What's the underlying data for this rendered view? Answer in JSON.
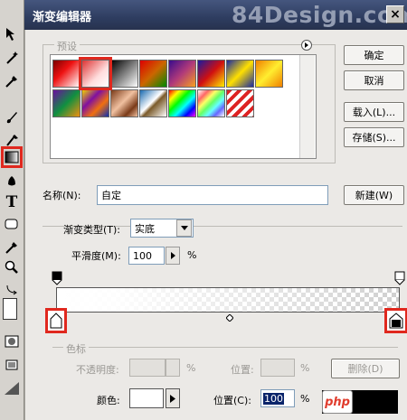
{
  "dialog": {
    "title": "渐变编辑器",
    "watermark": "84Design.com",
    "close_label": "×"
  },
  "buttons": {
    "ok": "确定",
    "cancel": "取消",
    "load": "载入(L)...",
    "save": "存储(S)...",
    "new": "新建(W)",
    "delete": "删除(D)"
  },
  "presets": {
    "label": "预设",
    "swatches": [
      {
        "name": "fg-to-bg",
        "bg": "linear-gradient(135deg,#7a0000,#e11 40%,#fff)"
      },
      {
        "name": "fg-to-transparent",
        "bg": "linear-gradient(135deg,#d33,#fdd 60%,#fff)"
      },
      {
        "name": "black-white",
        "bg": "linear-gradient(135deg,#000,#fff)"
      },
      {
        "name": "red-green",
        "bg": "linear-gradient(135deg,#d00,#c60 50%,#080)"
      },
      {
        "name": "violet-orange",
        "bg": "linear-gradient(135deg,#3a0c8c,#b03a7a 50%,#f7a020)"
      },
      {
        "name": "blue-red-yellow",
        "bg": "linear-gradient(135deg,#1a1aa0,#d01010 50%,#ffee00)"
      },
      {
        "name": "blue-yellow-blue",
        "bg": "linear-gradient(135deg,#1a2aa0,#ffe000 50%,#1a2aa0)"
      },
      {
        "name": "orange-yellow-orange",
        "bg": "linear-gradient(135deg,#f08000,#ffee30 50%,#f08000)"
      },
      {
        "name": "violet-green-orange",
        "bg": "linear-gradient(135deg,#6a0ca0,#109040 50%,#f09010)"
      },
      {
        "name": "yellow-violet-orange-blue",
        "bg": "linear-gradient(135deg,#f0d000,#8010a0 35%,#f07010 65%,#1030b0)"
      },
      {
        "name": "copper",
        "bg": "linear-gradient(135deg,#7a3a18,#f0c0a0 45%,#7a3a18 75%,#f0c0a0)"
      },
      {
        "name": "chrome",
        "bg": "linear-gradient(135deg,#1a6ab0,#fff 45%,#7a5a2a 55%,#fff)"
      },
      {
        "name": "spectrum",
        "bg": "linear-gradient(135deg,#f00,#ff0 20%,#0f0 40%,#0ff 60%,#00f 80%,#f0f)"
      },
      {
        "name": "transparent-rainbow",
        "bg": "linear-gradient(135deg,#fff,#f66 20%,#ff6 35%,#6f6 50%,#6ff 65%,#66f 80%,#fff)"
      },
      {
        "name": "transparent-stripes",
        "bg": "repeating-linear-gradient(135deg,#d22 0 4px,#fff 4px 8px)"
      }
    ],
    "menu_icon": "triangle-right-icon"
  },
  "name_field": {
    "label": "名称(N):",
    "value": "自定"
  },
  "gradient_type": {
    "label": "渐变类型(T):",
    "value": "实底"
  },
  "smoothness": {
    "label": "平滑度(M):",
    "value": "100",
    "unit": "%"
  },
  "stops": {
    "group_label": "色标",
    "opacity_label": "不透明度:",
    "opacity_unit": "%",
    "location_label_1": "位置:",
    "location_unit_1": "%",
    "color_label": "颜色:",
    "location_label_2": "位置(C):",
    "location_value_2": "100",
    "location_unit_2": "%"
  },
  "php_badge": "php",
  "colors": {
    "highlight": "#e0281e",
    "titlebar": "#2e3d60",
    "dialog_bg": "#ebe9e6",
    "php_blue": "#6c7fbf"
  }
}
